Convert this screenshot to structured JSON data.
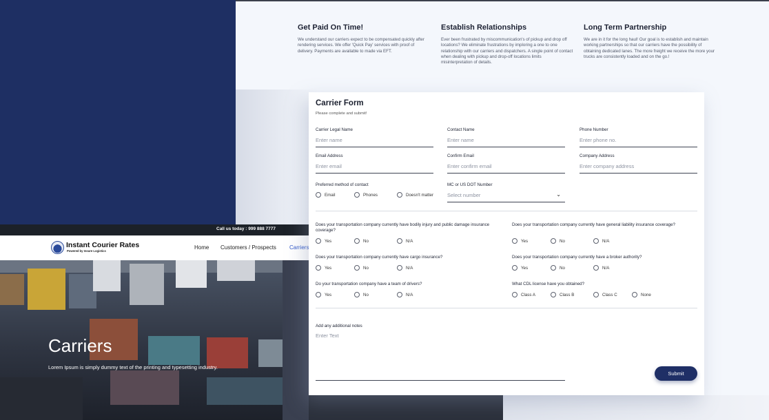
{
  "features": [
    {
      "title": "Get Paid On Time!",
      "text": "We understand our carriers expect to be compensated quickly after rendering services. We offer 'Quick Pay' services with proof of delivery. Payments are available to made via EFT."
    },
    {
      "title": "Establish Relationships",
      "text": "Ever been frustrated by miscommunication's of pickup and drop off locations? We eliminate frustrations by imploring a one to one relationship with our carriers and dispatchers. A single point of contact when dealing with pickup and drop-off locations limits misinterpretation of details."
    },
    {
      "title": "Long Term Partnership",
      "text": "We are in it for the long haul! Our goal is to establish and maintain working partnerships so that our carriers have the possibility of obtaining dedicated lanes. The more freight we receive the more your trucks are consistently loaded and on the go.!"
    }
  ],
  "site": {
    "call": "Call us today : 999 888 7777",
    "logo_title": "Instant Courier Rates",
    "logo_sub": "Powered by Insure Logistics",
    "nav": [
      "Home",
      "Customers / Prospects",
      "Carriers"
    ],
    "hero_title": "Carriers",
    "hero_sub": "Lorem Ipsum is simply dummy text of the printing and typesetting industry."
  },
  "form": {
    "title": "Carrier Form",
    "subtitle": "Please complete and submit!",
    "fields": {
      "legal_name": {
        "label": "Carrier Legal Name",
        "placeholder": "Enter name"
      },
      "contact_name": {
        "label": "Contact Name",
        "placeholder": "Enter name"
      },
      "phone": {
        "label": "Phone Number",
        "placeholder": "Enter phone no."
      },
      "email": {
        "label": "Email Address",
        "placeholder": "Enter email"
      },
      "confirm_email": {
        "label": "Confirm Email",
        "placeholder": "Enter confirm email"
      },
      "company_address": {
        "label": "Company Address",
        "placeholder": "Enter company address"
      },
      "dot_number": {
        "label": "MC or US DOT Number",
        "placeholder": "Select number"
      }
    },
    "contact_method": {
      "label": "Preferred method of contact",
      "options": [
        "Email",
        "Phones",
        "Doesn't matter"
      ]
    },
    "questions": [
      {
        "text": "Does your transportation company currently have bodily injury and public damage insurance coverage?",
        "options": [
          "Yes",
          "No",
          "N/A"
        ]
      },
      {
        "text": "Does your transportation company currently have general liability insurance coverage?",
        "options": [
          "Yes",
          "No",
          "N/A"
        ]
      },
      {
        "text": "Does your transportation company currently have cargo insurance?",
        "options": [
          "Yes",
          "No",
          "N/A"
        ]
      },
      {
        "text": "Does your transportation company currently have a broker authority?",
        "options": [
          "Yes",
          "No",
          "N/A"
        ]
      },
      {
        "text": "Do your transportation company have a team of drivers?",
        "options": [
          "Yes",
          "No",
          "N/A"
        ]
      },
      {
        "text": "What CDL license have you obtained?",
        "options": [
          "Class A",
          "Class B",
          "Class C",
          "None"
        ]
      }
    ],
    "notes": {
      "label": "Add any additional notes",
      "placeholder": "Enter Text"
    },
    "submit": "Submit"
  },
  "colors": {
    "navy": "#1e2f63",
    "accent": "#2d56c8"
  }
}
